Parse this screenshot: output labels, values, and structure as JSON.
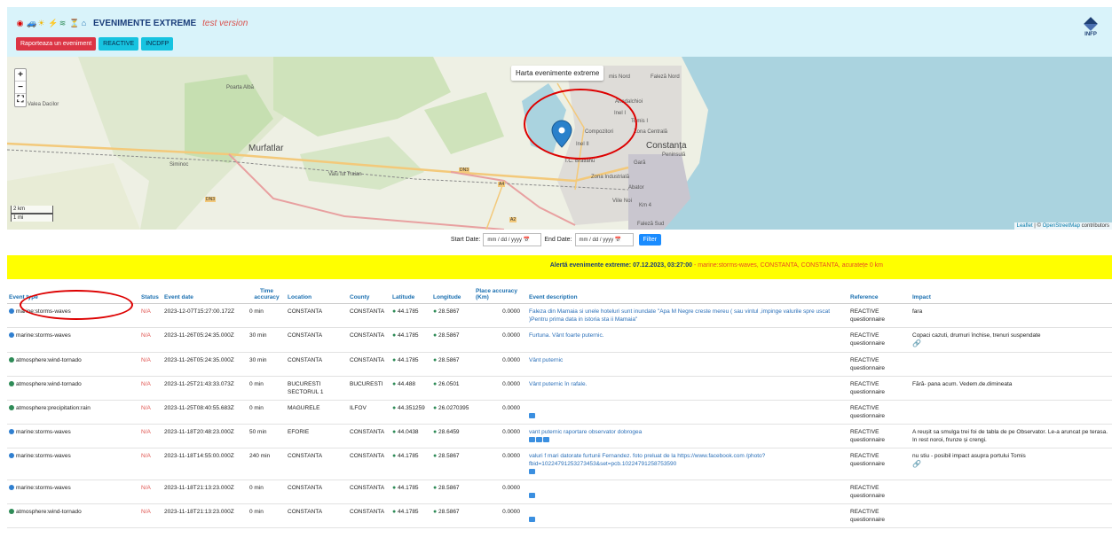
{
  "header": {
    "title": "EVENIMENTE EXTREME",
    "subtitle": "test version",
    "icons": [
      "target-icon",
      "car-icon",
      "sun-icon",
      "lightning-icon",
      "wave-icon",
      "snow-icon",
      "flood-icon"
    ],
    "buttons": {
      "report": "Raporteaza un eveniment",
      "reactive": "REACTIVE",
      "incdfp": "INCDFP"
    },
    "logo": "INFP"
  },
  "map": {
    "tooltip": "Harta evenimente extreme",
    "zoom_in": "+",
    "zoom_out": "−",
    "fullscreen": "⛶",
    "scale_km": "2 km",
    "scale_mi": "1 mi",
    "attribution_leaflet": "Leaflet",
    "attribution_sep": " | © ",
    "attribution_osm": "OpenStreetMap",
    "attribution_tail": " contributors",
    "places": {
      "valea_dacilor": "Valea Dacilor",
      "poarta_alba": "Poarta Albă",
      "siminoc": "Siminoc",
      "murfatlar": "Murfatlar",
      "valu_lui_traian": "Valu lui Traian",
      "mamaia_nord": "mis Nord",
      "faleza_nord": "Faleză Nord",
      "anadalchioi": "Anadalchioi",
      "inel1": "Inel I",
      "tomis1": "Tomis I",
      "compozitori": "Compozitori",
      "zona_centrala": "Zona Centrală",
      "inel2": "Inel II",
      "constanta": "Constanța",
      "peninsula": "Peninsulă",
      "ic_bratianu": "I.C. Brătianu",
      "gara": "Gară",
      "zona_industriala": "Zona Industrială",
      "abator": "Abator",
      "viile_noi": "Viile Noi",
      "km4": "Km 4",
      "faleza_sud": "Faleză Sud"
    },
    "roads": {
      "dn3_a": "DN3",
      "dn3_b": "DN3",
      "a4": "A4",
      "a2": "A2"
    }
  },
  "filter": {
    "start_label": "Start Date:",
    "start_value": "mm / dd / yyyy",
    "end_label": "End Date:",
    "end_value": "mm / dd / yyyy",
    "button": "Filter",
    "calendar_icon": "📅"
  },
  "alert": {
    "bold": "Alertă evenimente extreme: 07.12.2023, 03:27:00",
    "rest": " - marine:storms-waves, CONSTANTA, CONSTANTA, acuratețe 0 km"
  },
  "table": {
    "headers": {
      "event_type": "Event type",
      "status": "Status",
      "event_date": "Event date",
      "time_accuracy": "Time accuracy",
      "location": "Location",
      "county": "County",
      "latitude": "Latitude",
      "longitude": "Longitude",
      "place_accuracy": "Place accuracy (Km)",
      "description": "Event description",
      "reference": "Reference",
      "impact": "Impact"
    },
    "rows": [
      {
        "type": "marine:storms-waves",
        "color": "blue",
        "status": "N/A",
        "date": "2023-12-07T15:27:00.172Z",
        "tacc": "0 min",
        "location": "CONSTANTA",
        "county": "CONSTANTA",
        "lat": "44.1785",
        "lon": "28.5867",
        "pacc": "0.0000",
        "desc": "Faleza din Mamaia si unele hoteluri sunt inundate \"Apa M Negre creste mereu ( sau vintul ,impinge valurile spre uscat )Pentru prima data in istoria sta ii Mamaia\"",
        "images": 0,
        "ref": "REACTIVE questionnaire",
        "impact": "fara",
        "link": false
      },
      {
        "type": "marine:storms-waves",
        "color": "blue",
        "status": "N/A",
        "date": "2023-11-26T05:24:35.000Z",
        "tacc": "30 min",
        "location": "CONSTANTA",
        "county": "CONSTANTA",
        "lat": "44.1785",
        "lon": "28.5867",
        "pacc": "0.0000",
        "desc": "Furtuna. Vânt foarte puternic.",
        "images": 0,
        "ref": "REACTIVE questionnaire",
        "impact": "Copaci cazuti, drumuri închise, trenuri suspendate",
        "link": true
      },
      {
        "type": "atmosphere:wind-tornado",
        "color": "green",
        "status": "N/A",
        "date": "2023-11-26T05:24:35.000Z",
        "tacc": "30 min",
        "location": "CONSTANTA",
        "county": "CONSTANTA",
        "lat": "44.1785",
        "lon": "28.5867",
        "pacc": "0.0000",
        "desc": "Vânt puternic",
        "images": 0,
        "ref": "REACTIVE questionnaire",
        "impact": "",
        "link": false
      },
      {
        "type": "atmosphere:wind-tornado",
        "color": "green",
        "status": "N/A",
        "date": "2023-11-25T21:43:33.073Z",
        "tacc": "0 min",
        "location": "BUCURESTI SECTORUL 1",
        "county": "BUCURESTI",
        "lat": "44.488",
        "lon": "26.0501",
        "pacc": "0.0000",
        "desc": "Vânt puternic în rafale.",
        "images": 0,
        "ref": "REACTIVE questionnaire",
        "impact": "Fără- pana acum. Vedem.de.dimineata",
        "link": false
      },
      {
        "type": "atmosphere:precipitation:rain",
        "color": "green",
        "status": "N/A",
        "date": "2023-11-25T08:40:55.683Z",
        "tacc": "0 min",
        "location": "MAGURELE",
        "county": "ILFOV",
        "lat": "44.351259",
        "lon": "26.0270395",
        "pacc": "0.0000",
        "desc": "",
        "images": 1,
        "ref": "REACTIVE questionnaire",
        "impact": "",
        "link": false
      },
      {
        "type": "marine:storms-waves",
        "color": "blue",
        "status": "N/A",
        "date": "2023-11-18T20:48:23.000Z",
        "tacc": "50 min",
        "location": "EFORIE",
        "county": "CONSTANTA",
        "lat": "44.0438",
        "lon": "28.6459",
        "pacc": "0.0000",
        "desc": "vant puternic raportare observator dobrogea",
        "images": 3,
        "ref": "REACTIVE questionnaire",
        "impact": "A reușit sa smulga trei foi de tabla de pe Observator. Le-a aruncat pe terasa. In rest noroi, frunze și crengi.",
        "link": false
      },
      {
        "type": "marine:storms-waves",
        "color": "blue",
        "status": "N/A",
        "date": "2023-11-18T14:55:00.000Z",
        "tacc": "240 min",
        "location": "CONSTANTA",
        "county": "CONSTANTA",
        "lat": "44.1785",
        "lon": "28.5867",
        "pacc": "0.0000",
        "desc": "valuri f mari datorate furtunii Fernandez. foto preluat de la https://www.facebook.com /photo?fbid=10224791253273453&set=pcb.10224791258753590",
        "images": 1,
        "ref": "REACTIVE questionnaire",
        "impact": "nu stiu - posibil impact asupra portului Tomis",
        "link": true
      },
      {
        "type": "marine:storms-waves",
        "color": "blue",
        "status": "N/A",
        "date": "2023-11-18T21:13:23.000Z",
        "tacc": "0 min",
        "location": "CONSTANTA",
        "county": "CONSTANTA",
        "lat": "44.1785",
        "lon": "28.5867",
        "pacc": "0.0000",
        "desc": "",
        "images": 1,
        "ref": "REACTIVE questionnaire",
        "impact": "",
        "link": false
      },
      {
        "type": "atmosphere:wind-tornado",
        "color": "green",
        "status": "N/A",
        "date": "2023-11-18T21:13:23.000Z",
        "tacc": "0 min",
        "location": "CONSTANTA",
        "county": "CONSTANTA",
        "lat": "44.1785",
        "lon": "28.5867",
        "pacc": "0.0000",
        "desc": "",
        "images": 1,
        "ref": "REACTIVE questionnaire",
        "impact": "",
        "link": false
      }
    ]
  }
}
